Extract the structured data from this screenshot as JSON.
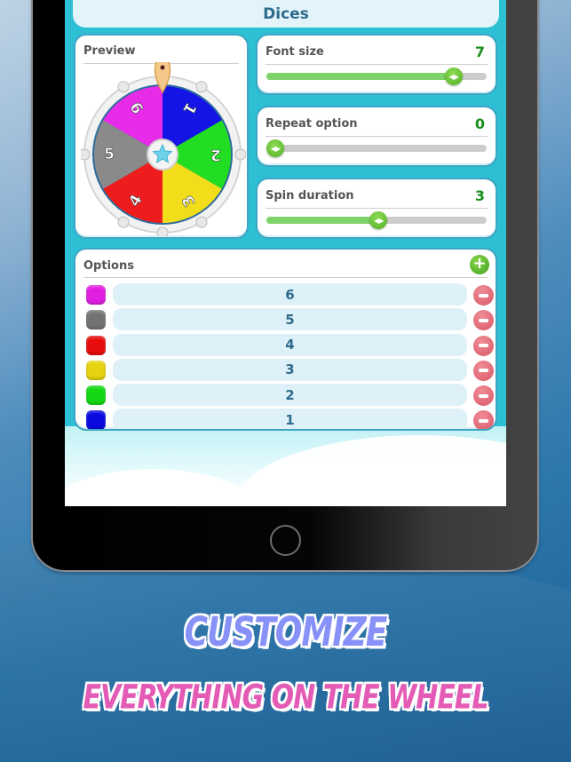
{
  "app": {
    "title": "Dices"
  },
  "preview": {
    "label": "Preview",
    "wheel_segments": [
      {
        "label": "1",
        "color": "#1414e6"
      },
      {
        "label": "2",
        "color": "#22dd22"
      },
      {
        "label": "3",
        "color": "#f2dd1a"
      },
      {
        "label": "4",
        "color": "#ee1c1c"
      },
      {
        "label": "5",
        "color": "#8a8a8a"
      },
      {
        "label": "6",
        "color": "#e82be8"
      }
    ]
  },
  "settings": {
    "font_size": {
      "label": "Font size",
      "value": "7",
      "fraction": 0.88
    },
    "repeat_option": {
      "label": "Repeat option",
      "value": "0",
      "fraction": 0.0
    },
    "spin_duration": {
      "label": "Spin duration",
      "value": "3",
      "fraction": 0.51
    }
  },
  "options": {
    "label": "Options",
    "add_icon": "plus-icon",
    "remove_icon": "minus-icon",
    "items": [
      {
        "value": "6",
        "color": "#e01ee0"
      },
      {
        "value": "5",
        "color": "#737373"
      },
      {
        "value": "4",
        "color": "#e80c0c"
      },
      {
        "value": "3",
        "color": "#e6d20e"
      },
      {
        "value": "2",
        "color": "#14d814"
      },
      {
        "value": "1",
        "color": "#0a0ae0"
      }
    ]
  },
  "promo": {
    "line1": "Customize",
    "line2": "Everything on the wheel"
  },
  "colors": {
    "accent_green": "#1a8f1a",
    "title_text": "#2d6b8b",
    "app_background": "#2dbfd3"
  }
}
